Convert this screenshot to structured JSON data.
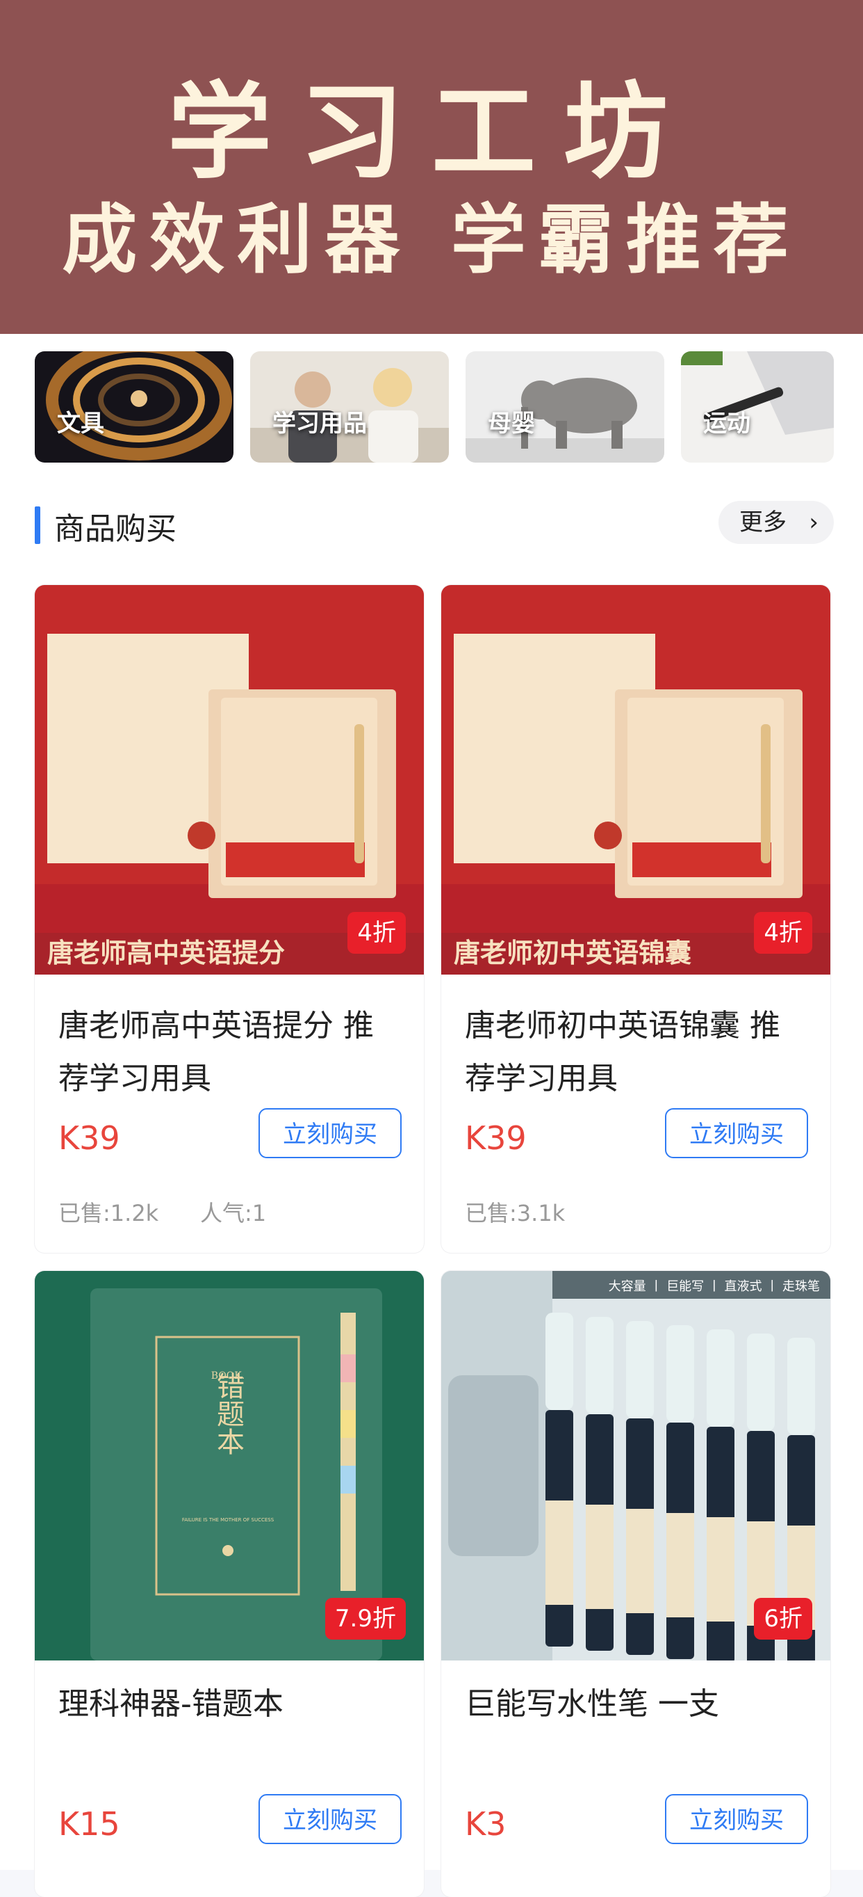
{
  "banner": {
    "title": "学习工坊",
    "subtitle": "成效利器 学霸推荐"
  },
  "categories": [
    {
      "label": "文具"
    },
    {
      "label": "学习用品"
    },
    {
      "label": "母婴"
    },
    {
      "label": "运动"
    }
  ],
  "section": {
    "title": "商品购买",
    "more_label": "更多"
  },
  "products": [
    {
      "name": "唐老师高中英语提分 推荐学习用具",
      "price": "K39",
      "discount": "4折",
      "buy_label": "立刻购买",
      "sold": "已售:1.2k",
      "popularity": "人气:1",
      "img_caption": "唐老师高中英语提分"
    },
    {
      "name": "唐老师初中英语锦囊 推荐学习用具",
      "price": "K39",
      "discount": "4折",
      "buy_label": "立刻购买",
      "sold": "已售:3.1k",
      "popularity": "",
      "img_caption": "唐老师初中英语锦囊"
    },
    {
      "name": "理科神器-错题本",
      "price": "K15",
      "discount": "7.9折",
      "buy_label": "立刻购买",
      "img_cover_small": "BOOK.",
      "img_cover_title": "错题本",
      "img_cover_motto": "FAILURE IS THE MOTHER OF SUCCESS"
    },
    {
      "name": "巨能写水性笔 一支",
      "price": "K3",
      "discount": "6折",
      "buy_label": "立刻购买",
      "img_tags": "大容量 丨 巨能写 丨 直液式 丨 走珠笔"
    }
  ],
  "colors": {
    "banner_bg": "#8e5252",
    "accent": "#2f7bf4",
    "price": "#e8453c",
    "discount_bg": "#e8202a"
  }
}
